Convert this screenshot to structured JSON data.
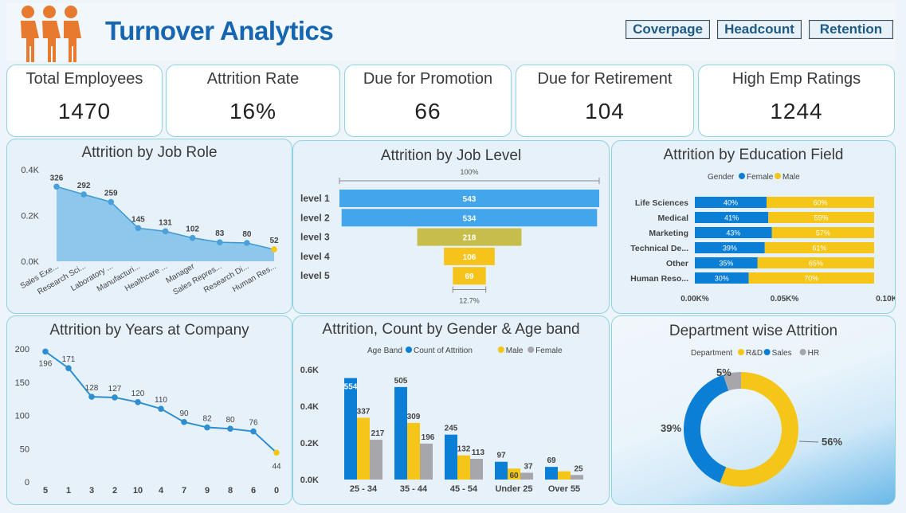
{
  "header": {
    "title": "Turnover Analytics",
    "nav": [
      "Coverpage",
      "Headcount",
      "Retention"
    ]
  },
  "kpis": [
    {
      "label": "Total Employees",
      "value": "1470"
    },
    {
      "label": "Attrition Rate",
      "value": "16%"
    },
    {
      "label": "Due for Promotion",
      "value": "66"
    },
    {
      "label": "Due for Retirement",
      "value": "104"
    },
    {
      "label": "High Emp Ratings",
      "value": "1244"
    }
  ],
  "colors": {
    "blue": "#0b7fd6",
    "yellow": "#f5c518",
    "gray": "#a7a7ab",
    "area": "#7cc0ea",
    "accent": "#1565b0",
    "funnel_blue": "#43a5ec",
    "funnel_olive": "#c7bd4a",
    "funnel_yellow": "#f6c31b",
    "person_orange": "#e87a2f"
  },
  "chart_data": [
    {
      "id": "job_role",
      "type": "area",
      "title": "Attrition by Job Role",
      "categories": [
        "Sales Exe...",
        "Research Sci...",
        "Laboratory ...",
        "Manufacturi...",
        "Healthcare ...",
        "Manager",
        "Sales Repres...",
        "Research Di...",
        "Human Res..."
      ],
      "values": [
        326,
        292,
        259,
        145,
        131,
        102,
        83,
        80,
        52
      ],
      "yticks": [
        "0.4K",
        "0.2K",
        "0.0K"
      ],
      "ylim": [
        0,
        400
      ]
    },
    {
      "id": "job_level",
      "type": "funnel",
      "title": "Attrition by Job Level",
      "categories": [
        "level 1",
        "level 2",
        "level 3",
        "level 4",
        "level 5"
      ],
      "values": [
        543,
        534,
        218,
        106,
        69
      ],
      "top_label": "100%",
      "bottom_label": "12.7%"
    },
    {
      "id": "education",
      "type": "bar",
      "stacked": "100%",
      "title": "Attrition by Education Field",
      "legend_title": "Gender",
      "series_names": [
        "Female",
        "Male"
      ],
      "categories": [
        "Life Sciences",
        "Medical",
        "Marketing",
        "Technical De...",
        "Other",
        "Human Reso..."
      ],
      "female_pct": [
        40,
        41,
        43,
        39,
        35,
        30
      ],
      "male_pct": [
        60,
        59,
        57,
        61,
        65,
        70
      ],
      "female_labels": [
        "40%",
        "41%",
        "43%",
        "39%",
        "35%",
        "30%"
      ],
      "male_labels": [
        "60%",
        "59%",
        "57%",
        "61%",
        "65%",
        "70%"
      ],
      "xticks": [
        "0.00K%",
        "0.05K%",
        "0.10K%"
      ],
      "legend_position": "top"
    },
    {
      "id": "years",
      "type": "line",
      "title": "Attrition by Years at Company",
      "categories": [
        "5",
        "1",
        "3",
        "2",
        "10",
        "4",
        "7",
        "9",
        "8",
        "6",
        "0"
      ],
      "values": [
        196,
        171,
        128,
        127,
        120,
        110,
        90,
        82,
        80,
        76,
        44
      ],
      "yticks": [
        "200",
        "150",
        "100",
        "50",
        "0"
      ],
      "ylim": [
        0,
        200
      ]
    },
    {
      "id": "gender_age",
      "type": "bar",
      "title": "Attrition, Count by Gender & Age band",
      "legend_title": "Age Band",
      "categories": [
        "25 - 34",
        "35 - 44",
        "45 - 54",
        "Under 25",
        "Over 55"
      ],
      "series": [
        {
          "name": "Count of Attrition",
          "values": [
            554,
            505,
            245,
            97,
            69
          ]
        },
        {
          "name": "Male",
          "values": [
            337,
            309,
            132,
            60,
            45
          ]
        },
        {
          "name": "Female",
          "values": [
            217,
            196,
            113,
            37,
            25
          ]
        }
      ],
      "labels": [
        [
          "554",
          "337",
          "217"
        ],
        [
          "505",
          "309",
          "196"
        ],
        [
          "245",
          "132",
          "113"
        ],
        [
          "97",
          "60",
          "37"
        ],
        [
          "69",
          "",
          "25"
        ]
      ],
      "yticks": [
        "0.6K",
        "0.4K",
        "0.2K",
        "0.0K"
      ],
      "ylim": [
        0,
        600
      ]
    },
    {
      "id": "department",
      "type": "pie",
      "donut": true,
      "title": "Department wise Attrition",
      "legend_title": "Department",
      "categories": [
        "R&D",
        "Sales",
        "HR"
      ],
      "values": [
        56,
        39,
        5
      ],
      "labels": [
        "56%",
        "39%",
        "5%"
      ]
    }
  ]
}
